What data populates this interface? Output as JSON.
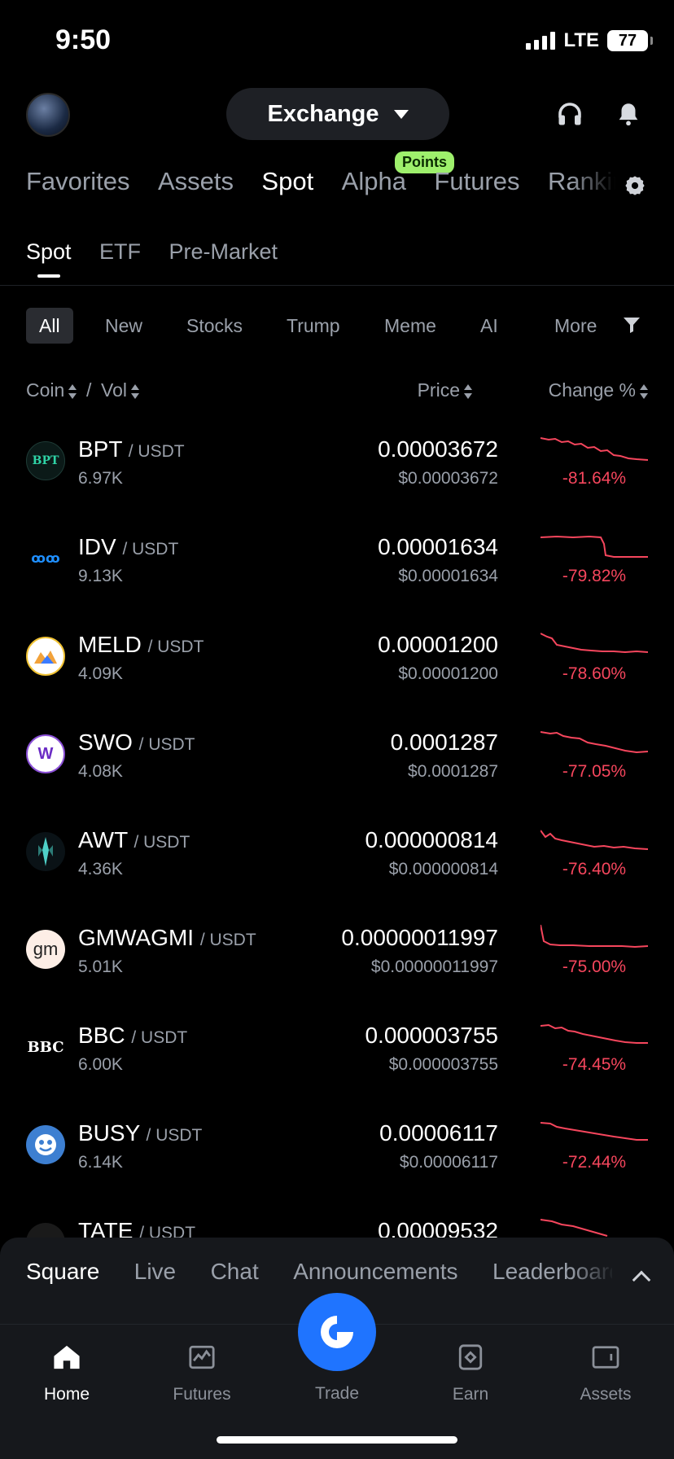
{
  "status_bar": {
    "time": "9:50",
    "network": "LTE",
    "battery": "77"
  },
  "header": {
    "exchange_label": "Exchange"
  },
  "top_tabs": [
    "Favorites",
    "Assets",
    "Spot",
    "Alpha",
    "Futures",
    "Ranking"
  ],
  "top_tab_active": "Spot",
  "points_badge": "Points",
  "sub_tabs": [
    "Spot",
    "ETF",
    "Pre-Market"
  ],
  "filters": [
    "All",
    "New",
    "Stocks",
    "Trump",
    "Meme",
    "AI",
    "More"
  ],
  "list_header": {
    "coin": "Coin",
    "sep": "/",
    "vol": "Vol",
    "price": "Price",
    "change": "Change %"
  },
  "coins": [
    {
      "symbol": "BPT",
      "quote": "/ USDT",
      "vol": "6.97K",
      "price": "0.00003672",
      "fiat": "$0.00003672",
      "change": "-81.64%"
    },
    {
      "symbol": "IDV",
      "quote": "/ USDT",
      "vol": "9.13K",
      "price": "0.00001634",
      "fiat": "$0.00001634",
      "change": "-79.82%"
    },
    {
      "symbol": "MELD",
      "quote": "/ USDT",
      "vol": "4.09K",
      "price": "0.00001200",
      "fiat": "$0.00001200",
      "change": "-78.60%"
    },
    {
      "symbol": "SWO",
      "quote": "/ USDT",
      "vol": "4.08K",
      "price": "0.0001287",
      "fiat": "$0.0001287",
      "change": "-77.05%"
    },
    {
      "symbol": "AWT",
      "quote": "/ USDT",
      "vol": "4.36K",
      "price": "0.000000814",
      "fiat": "$0.000000814",
      "change": "-76.40%"
    },
    {
      "symbol": "GMWAGMI",
      "quote": "/ USDT",
      "vol": "5.01K",
      "price": "0.00000011997",
      "fiat": "$0.00000011997",
      "change": "-75.00%"
    },
    {
      "symbol": "BBC",
      "quote": "/ USDT",
      "vol": "6.00K",
      "price": "0.000003755",
      "fiat": "$0.000003755",
      "change": "-74.45%"
    },
    {
      "symbol": "BUSY",
      "quote": "/ USDT",
      "vol": "6.14K",
      "price": "0.00006117",
      "fiat": "$0.00006117",
      "change": "-72.44%"
    },
    {
      "symbol": "TATE",
      "quote": "/ USDT",
      "vol": "",
      "price": "0.00009532",
      "fiat": "",
      "change": ""
    }
  ],
  "community_tabs": [
    "Square",
    "Live",
    "Chat",
    "Announcements",
    "Leaderboard"
  ],
  "bottom_nav": {
    "home": "Home",
    "futures": "Futures",
    "trade": "Trade",
    "earn": "Earn",
    "assets": "Assets"
  },
  "colors": {
    "negative": "#f6465d",
    "accent": "#1f74ff",
    "badge": "#9ef06c"
  }
}
